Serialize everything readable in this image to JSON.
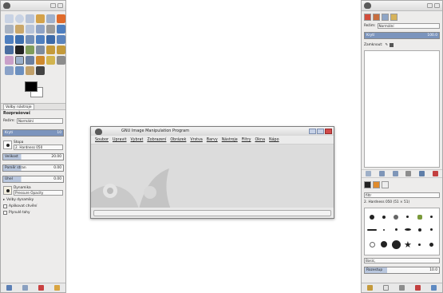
{
  "toolbox": {
    "tab_tool_options": "Volby nástroje",
    "options_title": "Rozprašovač",
    "mode_label": "Režim:",
    "mode_value": "Normální",
    "opacity_label": "Krytí",
    "opacity_value": "10",
    "brush_label": "Stopa",
    "brush_value": "2. Hardness 050",
    "size_label": "Velikost",
    "size_value": "20.00",
    "aspect_label": "Poměr stran",
    "aspect_value": "0.00",
    "angle_label": "Úhel",
    "angle_value": "0.00",
    "dynamics_label": "Dynamika",
    "dynamics_value": "Pressure Opacity",
    "dynamics_options": "Volby dynamiky",
    "apply_jitter": "Aplikovat chvění",
    "smooth_stroke": "Plynulé tahy"
  },
  "main_window": {
    "title": "GNU Image Manipulation Program",
    "menus": [
      "Soubor",
      "Upravit",
      "Vybrat",
      "Zobrazení",
      "Obrázek",
      "Vrstva",
      "Barvy",
      "Nástroje",
      "Filtry",
      "Okna",
      "Nápo"
    ]
  },
  "layers_panel": {
    "mode_label": "Režim:",
    "mode_value": "Normální",
    "opacity_label": "Krytí",
    "opacity_value": "100.0",
    "lock_label": "Zamknout:"
  },
  "brushes_panel": {
    "filter_value": "filtr",
    "brush_name": "2. Hardness 050 (51 × 51)",
    "preset_value": "Basic,",
    "spacing_label": "Rozestup",
    "spacing_value": "10.0"
  },
  "colors": {
    "accent": "#7b94bd",
    "fg": "#000000",
    "bg": "#ffffff",
    "close": "#d04a4a"
  }
}
